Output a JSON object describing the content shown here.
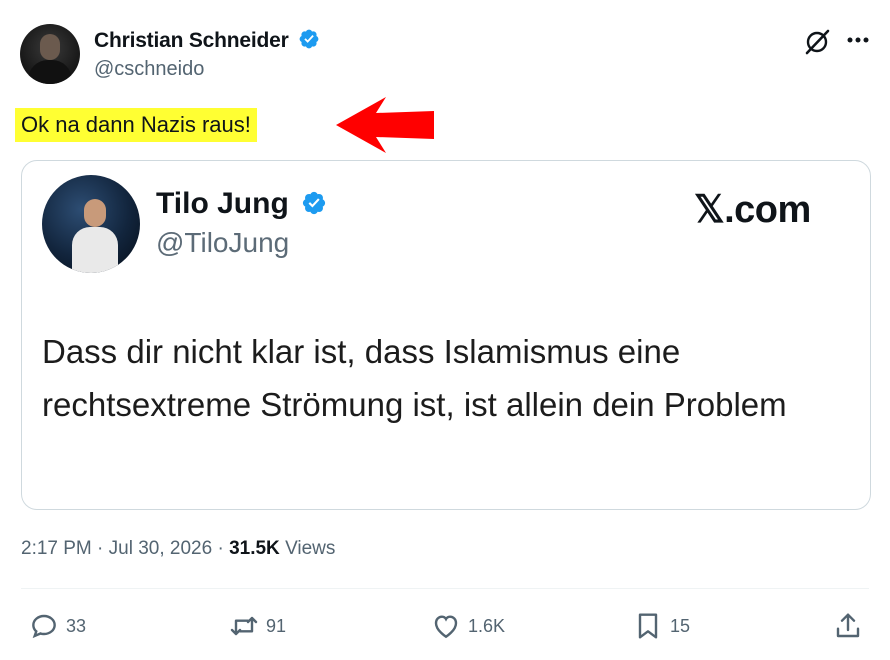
{
  "author": {
    "name": "Christian Schneider",
    "handle": "@cschneido"
  },
  "tweet_text": "Ok na dann Nazis raus!",
  "quoted": {
    "name": "Tilo Jung",
    "handle": "@TiloJung",
    "source": "𝕏.com",
    "body": "Dass dir nicht klar ist, dass Islamismus eine rechtsextreme Strömung ist, ist allein dein Problem"
  },
  "meta": {
    "time": "2:17 PM",
    "date": "Jul 30, 2026",
    "views_count": "31.5K",
    "views_label": "Views"
  },
  "actions": {
    "replies": "33",
    "reposts": "91",
    "likes": "1.6K",
    "bookmarks": "15"
  },
  "colors": {
    "verified": "#1d9bf0",
    "highlight": "#ffff33",
    "arrow": "#ff0000",
    "muted": "#536471"
  },
  "icons": [
    "grok-icon",
    "more-icon",
    "reply-icon",
    "repost-icon",
    "like-icon",
    "bookmark-icon",
    "share-icon",
    "verified-icon",
    "arrow-icon"
  ]
}
